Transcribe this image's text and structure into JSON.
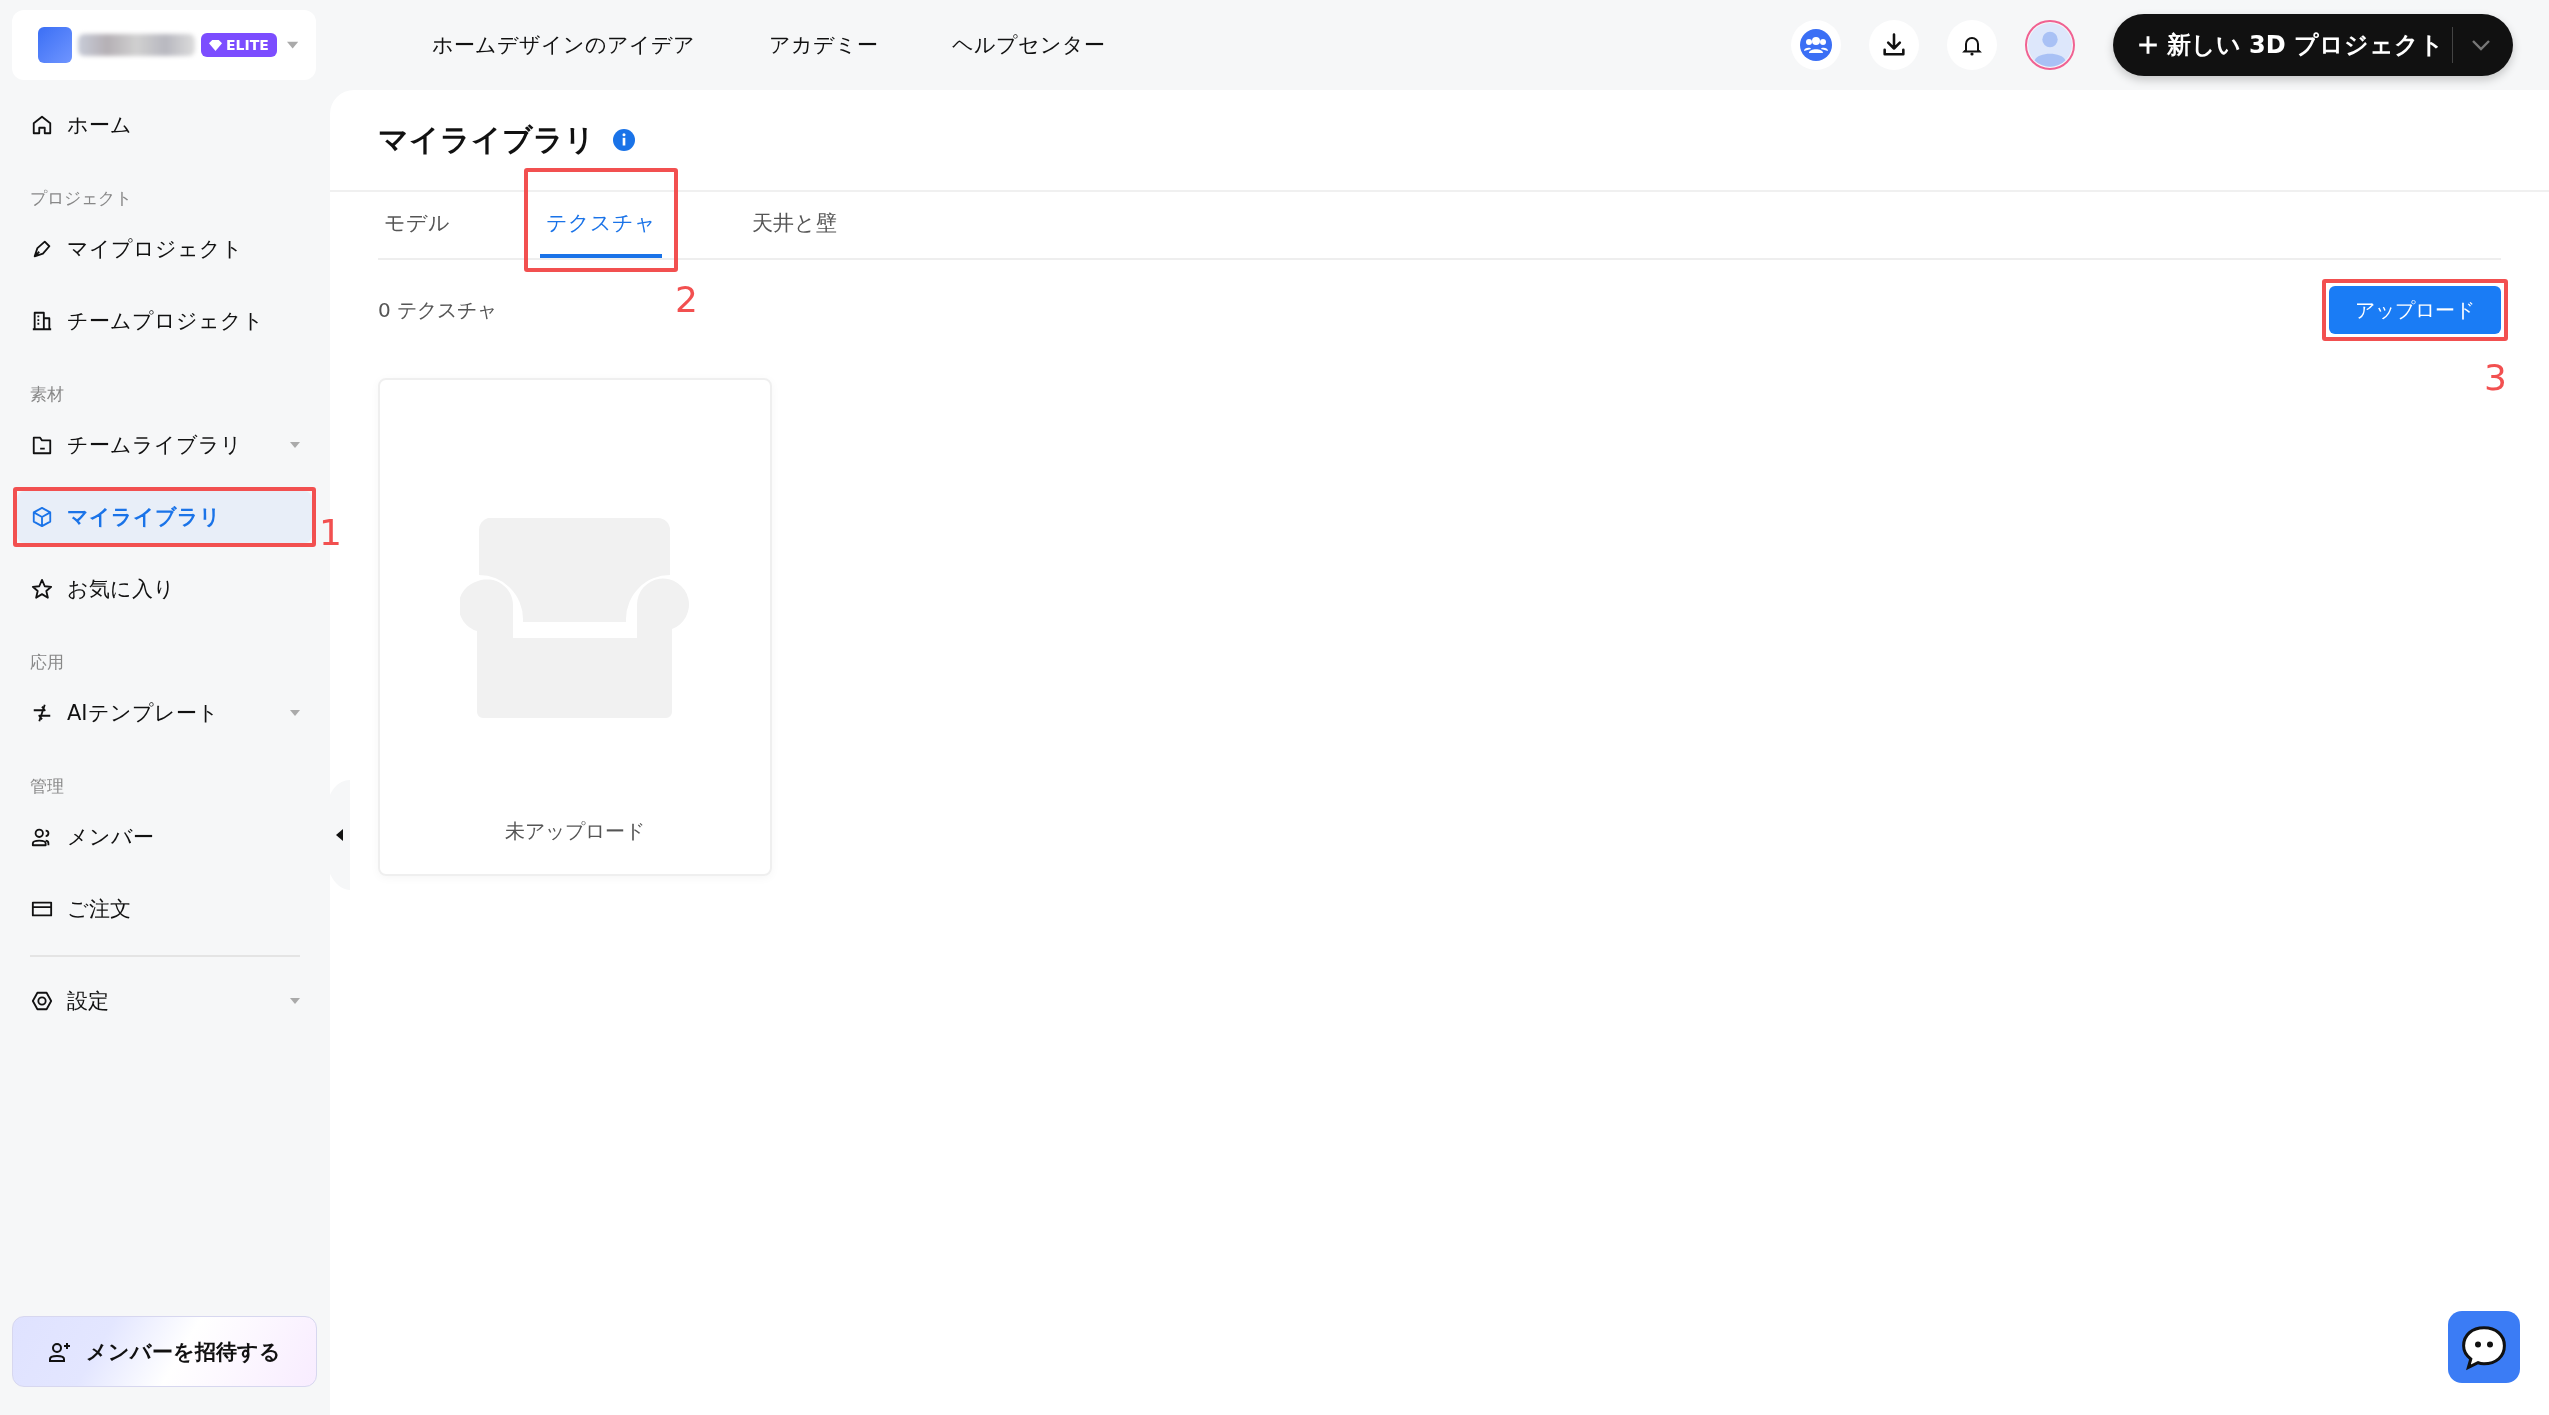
{
  "header": {
    "brand_badge": "ELITE",
    "nav": [
      "ホームデザインのアイデア",
      "アカデミー",
      "ヘルプセンター"
    ],
    "new_project_button": "新しい 3D プロジェクト"
  },
  "sidebar": {
    "items": [
      {
        "kind": "item",
        "label": "ホーム",
        "selected": false,
        "expandable": false
      },
      {
        "kind": "section",
        "label": "プロジェクト"
      },
      {
        "kind": "item",
        "label": "マイプロジェクト",
        "selected": false,
        "expandable": false
      },
      {
        "kind": "item",
        "label": "チームプロジェクト",
        "selected": false,
        "expandable": false
      },
      {
        "kind": "section",
        "label": "素材"
      },
      {
        "kind": "item",
        "label": "チームライブラリ",
        "selected": false,
        "expandable": true
      },
      {
        "kind": "item",
        "label": "マイライブラリ",
        "selected": true,
        "expandable": false,
        "annotation": "1"
      },
      {
        "kind": "item",
        "label": "お気に入り",
        "selected": false,
        "expandable": false
      },
      {
        "kind": "section",
        "label": "応用"
      },
      {
        "kind": "item",
        "label": "AIテンプレート",
        "selected": false,
        "expandable": true
      },
      {
        "kind": "section",
        "label": "管理"
      },
      {
        "kind": "item",
        "label": "メンバー",
        "selected": false,
        "expandable": false
      },
      {
        "kind": "item",
        "label": "ご注文",
        "selected": false,
        "expandable": false
      },
      {
        "kind": "divider"
      },
      {
        "kind": "item",
        "label": "設定",
        "selected": false,
        "expandable": true
      }
    ],
    "invite_button": "メンバーを招待する"
  },
  "main": {
    "title": "マイライブラリ",
    "tabs": [
      {
        "label": "モデル",
        "selected": false
      },
      {
        "label": "テクスチャ",
        "selected": true,
        "annotation": "2"
      },
      {
        "label": "天井と壁",
        "selected": false
      }
    ],
    "count": "0 テクスチャ",
    "upload_button": {
      "label": "アップロード",
      "annotation": "3"
    },
    "cards": [
      {
        "caption": "未アップロード"
      }
    ]
  }
}
